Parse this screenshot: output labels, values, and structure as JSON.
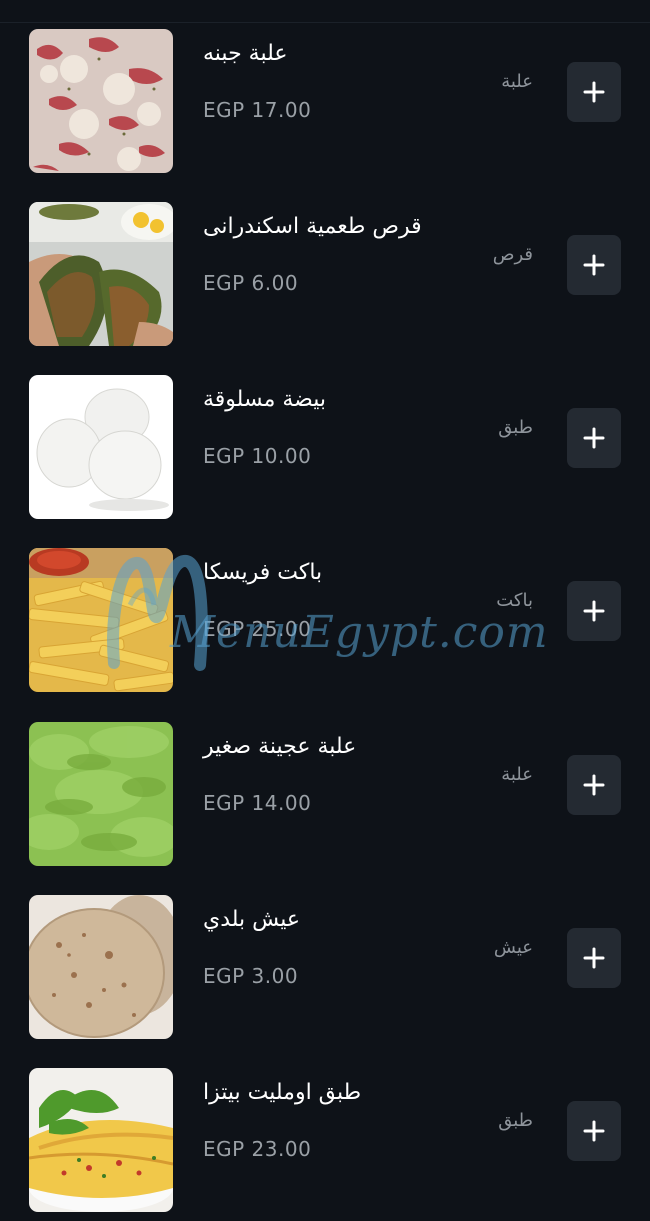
{
  "theme": {
    "background": "#0e1218",
    "button_background": "#242a32",
    "text_primary": "#ffffff",
    "text_secondary": "#8e949b"
  },
  "watermark": {
    "text": "MenuEgypt.com"
  },
  "items": [
    {
      "name": "علبة جبنه",
      "unit": "علبة",
      "price": "EGP 17.00",
      "image": "cheese-tomato"
    },
    {
      "name": "قرص طعمية اسكندرانى",
      "unit": "قرص",
      "price": "EGP 6.00",
      "image": "falafel"
    },
    {
      "name": "بيضة مسلوقة",
      "unit": "طبق",
      "price": "EGP 10.00",
      "image": "boiled-eggs"
    },
    {
      "name": "باكت فريسكا",
      "unit": "باكت",
      "price": "EGP 25.00",
      "image": "fries"
    },
    {
      "name": "علبة عجينة صغير",
      "unit": "علبة",
      "price": "EGP 14.00",
      "image": "green-dough"
    },
    {
      "name": "عيش بلدي",
      "unit": "عيش",
      "price": "EGP 3.00",
      "image": "baladi-bread"
    },
    {
      "name": "طبق اومليت بيتزا",
      "unit": "طبق",
      "price": "EGP 23.00",
      "image": "omelette"
    }
  ],
  "add_button": {
    "icon": "plus-icon"
  }
}
